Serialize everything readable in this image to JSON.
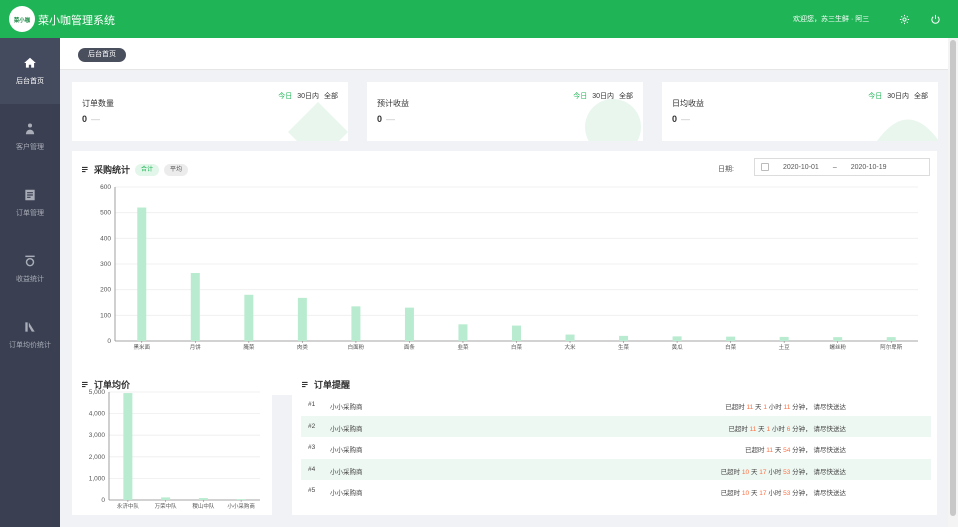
{
  "header": {
    "logo_text": "菜小咖",
    "app_title": "菜小咖管理系统",
    "welcome": "欢迎您，苏三生鲜 · 阿三",
    "settings_icon": "gear-icon",
    "power_icon": "power-icon"
  },
  "sidebar": {
    "items": [
      {
        "label": "后台首页",
        "icon": "home-icon"
      },
      {
        "label": "客户管理",
        "icon": "users-icon"
      },
      {
        "label": "订单管理",
        "icon": "order-icon"
      },
      {
        "label": "收益统计",
        "icon": "income-icon"
      },
      {
        "label": "订单均价统计",
        "icon": "price-icon"
      }
    ]
  },
  "breadcrumb": "后台首页",
  "periods": [
    "今日",
    "30日内",
    "全部"
  ],
  "stats": [
    {
      "title": "订单数量",
      "value": "0"
    },
    {
      "title": "预计收益",
      "value": "0"
    },
    {
      "title": "日均收益",
      "value": "0"
    }
  ],
  "purchase": {
    "title": "采购统计",
    "tab_sum": "合计",
    "tab_avg": "平均",
    "date_label": "日期:",
    "date_start": "2020-10-01",
    "date_sep": "–",
    "date_end": "2020-10-19"
  },
  "avg_panel": {
    "title": "订单均价"
  },
  "reminder": {
    "title": "订单提醒",
    "rows": [
      {
        "idx": "#1",
        "name": "小小采购商",
        "d": "11",
        "h": "1",
        "m": "11"
      },
      {
        "idx": "#2",
        "name": "小小采购商",
        "d": "11",
        "h": "1",
        "m": "6"
      },
      {
        "idx": "#3",
        "name": "小小采购商",
        "d": "11",
        "h": "",
        "m": "54"
      },
      {
        "idx": "#4",
        "name": "小小采购商",
        "d": "10",
        "h": "17",
        "m": "53"
      },
      {
        "idx": "#5",
        "name": "小小采购商",
        "d": "10",
        "h": "17",
        "m": "53"
      }
    ],
    "t_prefix": "已超时",
    "t_day": "天",
    "t_hour": "小时",
    "t_min": "分钟，",
    "t_suffix": "请尽快送达"
  },
  "colors": {
    "brand": "#1fb556",
    "bar": "#b8ebcf",
    "sidebar": "#3a3f51",
    "overdue": "#ff7043"
  },
  "chart_data": [
    {
      "type": "bar",
      "title": "采购统计",
      "categories": [
        "黑米面",
        "月饼",
        "腌菜",
        "肉类",
        "白面粉",
        "面条",
        "韭菜",
        "白菜",
        "大米",
        "生菜",
        "黄瓜",
        "白菜",
        "土豆",
        "螺丝粉",
        "阿尔卑斯"
      ],
      "values": [
        520,
        265,
        180,
        168,
        135,
        130,
        65,
        60,
        25,
        20,
        18,
        17,
        16,
        15,
        15
      ],
      "yticks": [
        0,
        100,
        200,
        300,
        400,
        500,
        600
      ],
      "ylim": [
        0,
        600
      ]
    },
    {
      "type": "bar",
      "title": "订单均价",
      "categories": [
        "永济中队",
        "万荣中队",
        "稷山中队",
        "小小采购商"
      ],
      "values": [
        4950,
        120,
        90,
        40
      ],
      "yticks": [
        "0",
        "1,000",
        "2,000",
        "3,000",
        "4,000",
        "5,000"
      ],
      "ylim": [
        0,
        5000
      ]
    }
  ]
}
